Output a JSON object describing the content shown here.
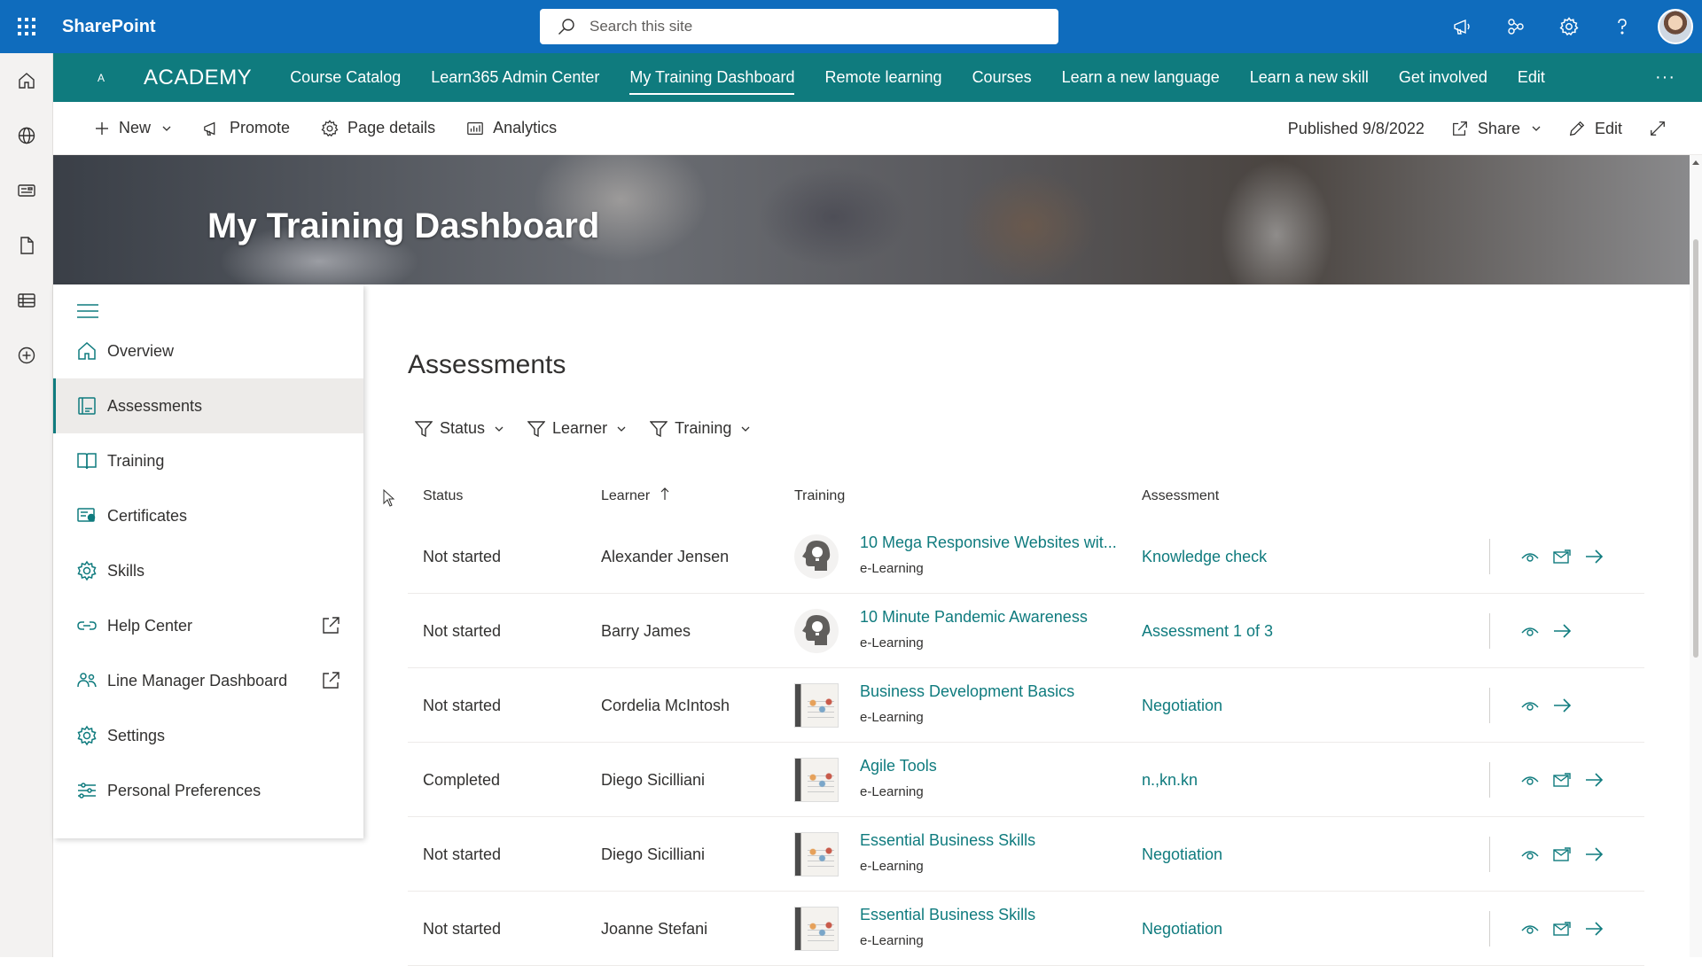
{
  "suite": {
    "app_name": "SharePoint",
    "search_placeholder": "Search this site"
  },
  "hub": {
    "logo_letter": "A",
    "title": "ACADEMY",
    "links": [
      "Course Catalog",
      "Learn365 Admin Center",
      "My Training Dashboard",
      "Remote learning",
      "Courses",
      "Learn a new language",
      "Learn a new skill",
      "Get involved",
      "Edit"
    ],
    "active_link": "My Training Dashboard",
    "more": "···"
  },
  "command_bar": {
    "new": "New",
    "promote": "Promote",
    "page_details": "Page details",
    "analytics": "Analytics",
    "published": "Published 9/8/2022",
    "share": "Share",
    "edit": "Edit"
  },
  "hero": {
    "title": "My Training Dashboard"
  },
  "sidenav": {
    "items": [
      {
        "label": "Overview",
        "icon": "home-icon"
      },
      {
        "label": "Assessments",
        "icon": "assessment-icon"
      },
      {
        "label": "Training",
        "icon": "book-icon"
      },
      {
        "label": "Certificates",
        "icon": "certificate-icon"
      },
      {
        "label": "Skills",
        "icon": "skills-icon"
      },
      {
        "label": "Help Center",
        "icon": "link-icon"
      },
      {
        "label": "Line Manager Dashboard",
        "icon": "team-icon"
      },
      {
        "label": "Settings",
        "icon": "gear-icon"
      },
      {
        "label": "Personal Preferences",
        "icon": "sliders-icon"
      }
    ],
    "active": "Assessments"
  },
  "main": {
    "title": "Assessments",
    "filters": [
      "Status",
      "Learner",
      "Training"
    ],
    "columns": {
      "status": "Status",
      "learner": "Learner",
      "training": "Training",
      "assessment": "Assessment"
    },
    "rows": [
      {
        "status": "Not started",
        "learner": "Alexander Jensen",
        "training": "10 Mega Responsive Websites wit...",
        "type": "e-Learning",
        "assessment": "Knowledge check",
        "thumb": "brain",
        "mail": true
      },
      {
        "status": "Not started",
        "learner": "Barry James",
        "training": "10 Minute Pandemic Awareness",
        "type": "e-Learning",
        "assessment": "Assessment 1 of 3",
        "thumb": "brain",
        "mail": false
      },
      {
        "status": "Not started",
        "learner": "Cordelia McIntosh",
        "training": "Business Development Basics",
        "type": "e-Learning",
        "assessment": "Negotiation",
        "thumb": "photo",
        "mail": false
      },
      {
        "status": "Completed",
        "learner": "Diego Sicilliani",
        "training": "Agile Tools",
        "type": "e-Learning",
        "assessment": "n.,kn.kn",
        "thumb": "photo",
        "mail": true
      },
      {
        "status": "Not started",
        "learner": "Diego Sicilliani",
        "training": "Essential Business Skills",
        "type": "e-Learning",
        "assessment": "Negotiation",
        "thumb": "photo",
        "mail": true
      },
      {
        "status": "Not started",
        "learner": "Joanne Stefani",
        "training": "Essential Business Skills",
        "type": "e-Learning",
        "assessment": "Negotiation",
        "thumb": "photo",
        "mail": true
      }
    ]
  },
  "colors": {
    "suite_bar": "#0f6cbd",
    "hub_nav": "#0f7b7e",
    "link": "#0f7b7e"
  }
}
